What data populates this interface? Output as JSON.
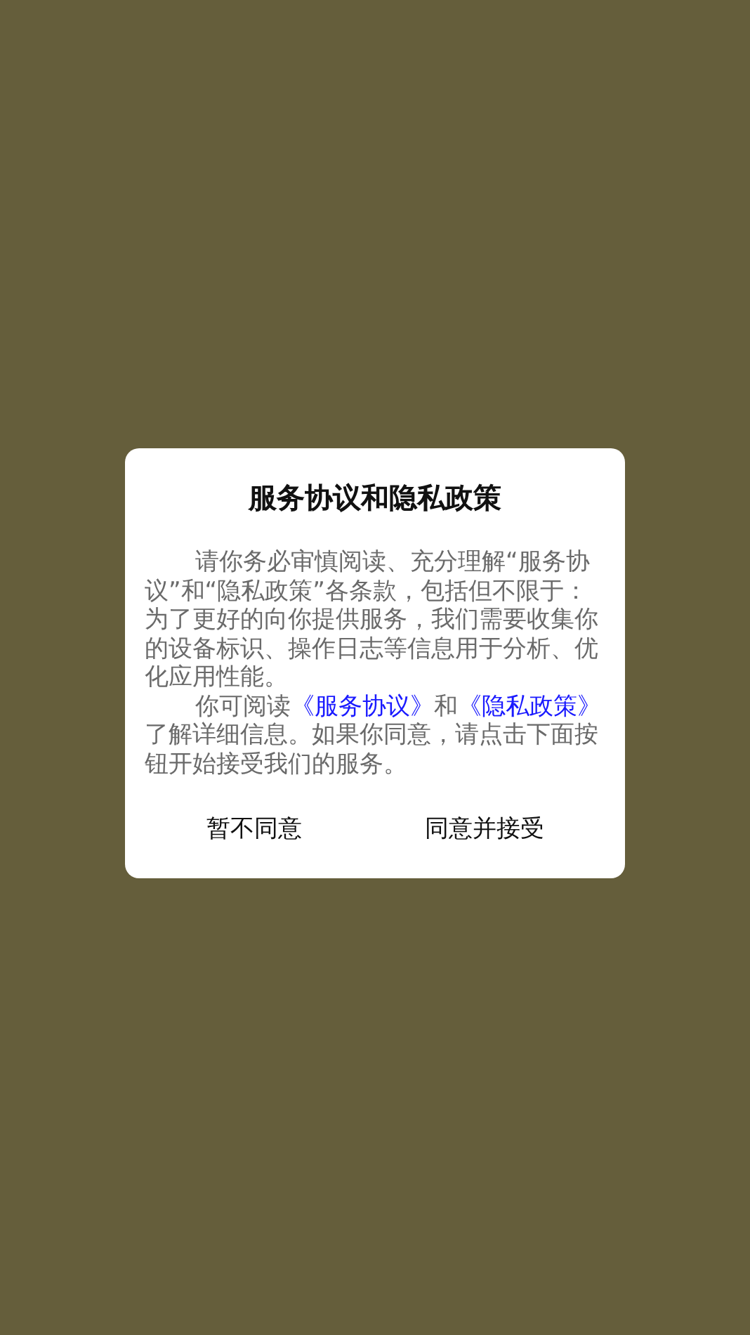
{
  "dialog": {
    "title": "服务协议和隐私政策",
    "paragraphs": [
      {
        "segments": [
          {
            "kind": "text",
            "text": "请你务必审慎阅读、充分理解“服务协议”和“隐私政策”各条款，包括但不限于：为了更好的向你提供服务，我们需要收集你的设备标识、操作日志等信息用于分析、优化应用性能。"
          }
        ]
      },
      {
        "segments": [
          {
            "kind": "text",
            "text": "你可阅读"
          },
          {
            "kind": "link",
            "text": "《服务协议》"
          },
          {
            "kind": "text",
            "text": "和"
          },
          {
            "kind": "link",
            "text": "《隐私政策》"
          },
          {
            "kind": "text",
            "text": "了解详细信息。如果你同意，请点击下面按钮开始接受我们的服务。"
          }
        ]
      }
    ],
    "buttons": [
      {
        "label": "暂不同意"
      },
      {
        "label": "同意并接受"
      }
    ]
  }
}
